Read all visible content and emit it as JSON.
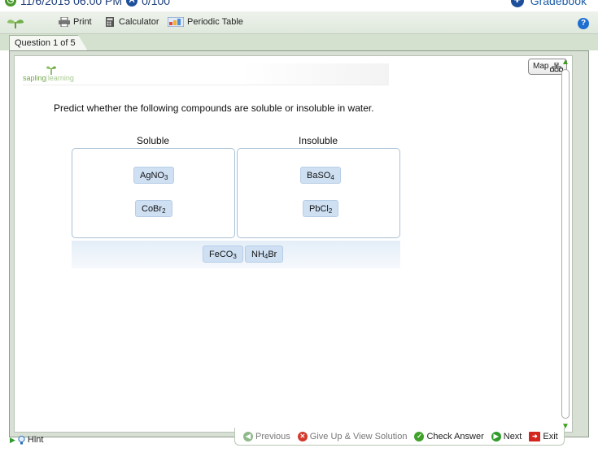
{
  "status": {
    "datetime": "11/6/2015 06:00 PM",
    "score": "0/100",
    "score_icon_letter": "A",
    "gradebook": "Gradebook"
  },
  "toolbar": {
    "print": "Print",
    "calculator": "Calculator",
    "periodic_table": "Periodic Table",
    "help": "?"
  },
  "tab": {
    "question": "Question 1 of 5"
  },
  "logo": {
    "sapling": "sapling",
    "learning": "learning"
  },
  "map_button": "Map",
  "question": {
    "prompt": "Predict whether the following compounds are soluble or insoluble in water.",
    "soluble_heading": "Soluble",
    "insoluble_heading": "Insoluble",
    "soluble_items": [
      {
        "formula_base": "AgNO",
        "subscript": "3",
        "suffix": ""
      },
      {
        "formula_base": "CoBr",
        "subscript": "2",
        "suffix": ""
      }
    ],
    "insoluble_items": [
      {
        "formula_base": "BaSO",
        "subscript": "4",
        "suffix": ""
      },
      {
        "formula_base": "PbCl",
        "subscript": "2",
        "suffix": ""
      }
    ],
    "unplaced_items": [
      {
        "formula_base": "FeCO",
        "subscript": "3",
        "suffix": ""
      },
      {
        "formula_base": "NH",
        "subscript": "4",
        "suffix": "Br"
      }
    ]
  },
  "nav": {
    "previous": "Previous",
    "give_up": "Give Up & View Solution",
    "check_answer": "Check Answer",
    "next": "Next",
    "exit": "Exit",
    "hint": "Hint"
  },
  "colors": {
    "accent_green": "#3fa12a",
    "chip_blue": "#cfe0f3",
    "bin_border": "#a9c1d6",
    "toolbar_bg": "#dfe8dc"
  }
}
